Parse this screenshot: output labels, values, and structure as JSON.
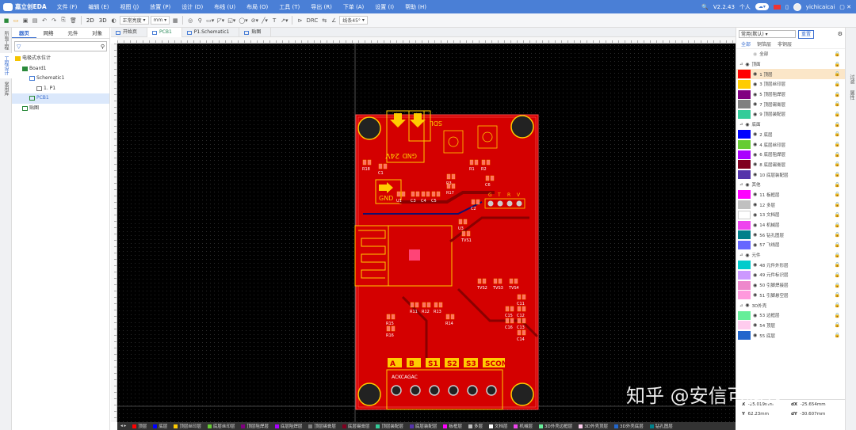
{
  "app": {
    "logo": "嘉立创EDA",
    "version": "V2.2.43",
    "user_mode": "个人",
    "user_name": "yichicaicai"
  },
  "menu": [
    "文件 (F)",
    "编辑 (E)",
    "视图 (J)",
    "放置 (P)",
    "设计 (D)",
    "布线 (U)",
    "布局 (O)",
    "工具 (T)",
    "导出 (R)",
    "下单 (A)",
    "设置 (I)",
    "帮助 (H)"
  ],
  "toolbar": {
    "view2d": "2D",
    "view3d": "3D",
    "display_mode": "正常亮度",
    "unit": "mm",
    "angle": "线条45°"
  },
  "left_rail": [
    "所有工程",
    "工程设计",
    "常用库"
  ],
  "left_tabs": [
    "器页",
    "网络",
    "元件",
    "对象"
  ],
  "tree": [
    {
      "label": "电极式水位计",
      "level": 0
    },
    {
      "label": "Board1",
      "level": 1
    },
    {
      "label": "Schematic1",
      "level": 2
    },
    {
      "label": "1. P1",
      "level": 3
    },
    {
      "label": "PCB1",
      "level": 2
    },
    {
      "label": "贴图",
      "level": 1
    }
  ],
  "doc_tabs": [
    "开始页",
    "PCB1",
    "P1.Schematic1",
    "贴图"
  ],
  "pcb": {
    "labels": {
      "power": "24V",
      "gnd": "GND",
      "gnd2": "GND",
      "sdl": "SDL",
      "ap": "ACKCAGAC"
    },
    "terminals": [
      "A",
      "B",
      "S1",
      "S2",
      "S3",
      "SCOM"
    ],
    "pins": [
      "G",
      "T",
      "R",
      "V"
    ],
    "parts": [
      "U1",
      "C3",
      "C4",
      "C5",
      "C6",
      "R1",
      "R2",
      "R3",
      "R17",
      "R18",
      "C1",
      "C2",
      "U3",
      "TVS1",
      "TVS2",
      "TVS3",
      "TVS4",
      "C11",
      "C12",
      "C13",
      "C14",
      "C15",
      "C16",
      "R11",
      "R12",
      "R13",
      "R14",
      "R15",
      "R16"
    ]
  },
  "right_rail": [
    "过滤",
    "属性"
  ],
  "layer_panel": {
    "preset": "常用(默认)",
    "reset": "重置",
    "tabs": [
      "全部",
      "铜箔层",
      "非铜层"
    ],
    "layers": [
      {
        "name": "全部",
        "color": "",
        "group": false
      },
      {
        "name": "顶面",
        "color": "",
        "group": true
      },
      {
        "name": "1 顶层",
        "color": "#ff0000",
        "group": false,
        "active": true
      },
      {
        "name": "3 顶层丝印层",
        "color": "#ffcc00",
        "group": false
      },
      {
        "name": "5 顶层阻焊层",
        "color": "#800080",
        "group": false
      },
      {
        "name": "7 顶层锡膏层",
        "color": "#808080",
        "group": false
      },
      {
        "name": "9 顶层装配层",
        "color": "#33cc99",
        "group": false
      },
      {
        "name": "底面",
        "color": "",
        "group": true
      },
      {
        "name": "2 底层",
        "color": "#0000ff",
        "group": false
      },
      {
        "name": "4 底层丝印层",
        "color": "#66cc33",
        "group": false
      },
      {
        "name": "6 底层阻焊层",
        "color": "#aa00ff",
        "group": false
      },
      {
        "name": "8 底层锡膏层",
        "color": "#800020",
        "group": false
      },
      {
        "name": "10 底层装配层",
        "color": "#5533aa",
        "group": false
      },
      {
        "name": "其他",
        "color": "",
        "group": true
      },
      {
        "name": "11 板框层",
        "color": "#ff00ff",
        "group": false
      },
      {
        "name": "12 多层",
        "color": "#c0c0c0",
        "group": false
      },
      {
        "name": "13 文档层",
        "color": "#ffffff",
        "group": false
      },
      {
        "name": "14 机械层",
        "color": "#ee44ee",
        "group": false
      },
      {
        "name": "56 钻孔图层",
        "color": "#00808a",
        "group": false
      },
      {
        "name": "57 飞线层",
        "color": "#6666ff",
        "group": false
      },
      {
        "name": "元件",
        "color": "",
        "group": true
      },
      {
        "name": "48 元件外形层",
        "color": "#00cccc",
        "group": false
      },
      {
        "name": "49 元件标识层",
        "color": "#cc99ff",
        "group": false
      },
      {
        "name": "50 引脚焊接层",
        "color": "#ee88cc",
        "group": false
      },
      {
        "name": "51 引脚悬空层",
        "color": "#ff99dd",
        "group": false
      },
      {
        "name": "3D外壳",
        "color": "",
        "group": true
      },
      {
        "name": "53 边框层",
        "color": "#66ee99",
        "group": false
      },
      {
        "name": "54 顶层",
        "color": "#ffccee",
        "group": false
      },
      {
        "name": "55 底层",
        "color": "#2266cc",
        "group": false
      }
    ]
  },
  "coords": {
    "x_label": "X",
    "x": "-25.019mm",
    "dx_label": "dX",
    "dx": "-25.654mm",
    "y_label": "Y",
    "y": "62.23mm",
    "dy_label": "dY",
    "dy": "-30.607mm"
  },
  "status_layers": [
    {
      "name": "顶层",
      "color": "#ff0000"
    },
    {
      "name": "底层",
      "color": "#0000ff"
    },
    {
      "name": "顶层丝印层",
      "color": "#ffcc00"
    },
    {
      "name": "底层丝印层",
      "color": "#66cc33"
    },
    {
      "name": "顶层阻焊层",
      "color": "#800080"
    },
    {
      "name": "底层阻焊层",
      "color": "#aa00ff"
    },
    {
      "name": "顶层锡膏层",
      "color": "#808080"
    },
    {
      "name": "底层锡膏层",
      "color": "#800020"
    },
    {
      "name": "顶层装配层",
      "color": "#33cc99"
    },
    {
      "name": "底层装配层",
      "color": "#5533aa"
    },
    {
      "name": "板框层",
      "color": "#ff00ff"
    },
    {
      "name": "多层",
      "color": "#c0c0c0"
    },
    {
      "name": "文档层",
      "color": "#ffffff"
    },
    {
      "name": "机械层",
      "color": "#ee44ee"
    },
    {
      "name": "3D外壳边框层",
      "color": "#66ee99"
    },
    {
      "name": "3D外壳顶层",
      "color": "#ffccee"
    },
    {
      "name": "3D外壳底层",
      "color": "#2266cc"
    },
    {
      "name": "钻孔图层",
      "color": "#00808a"
    }
  ],
  "watermark": "知乎 @安信可科技"
}
